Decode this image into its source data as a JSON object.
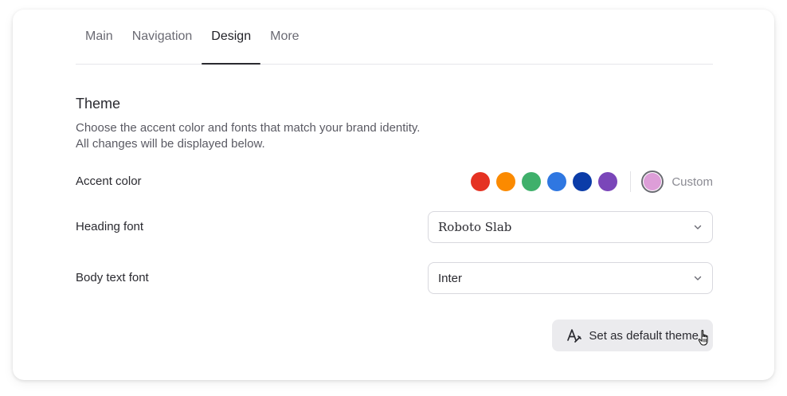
{
  "tabs": [
    {
      "label": "Main"
    },
    {
      "label": "Navigation"
    },
    {
      "label": "Design"
    },
    {
      "label": "More"
    }
  ],
  "active_tab": "Design",
  "theme": {
    "title": "Theme",
    "description_line1": "Choose the accent color and fonts that match your brand identity.",
    "description_line2": "All changes will be displayed below."
  },
  "accent": {
    "label": "Accent color",
    "colors": [
      "#e53222",
      "#fb8a00",
      "#3fb06b",
      "#2f77e1",
      "#0b3ca8",
      "#7a46b9"
    ],
    "custom_color": "#dd9ed8",
    "custom_label": "Custom"
  },
  "heading_font": {
    "label": "Heading font",
    "value": "Roboto Slab"
  },
  "body_font": {
    "label": "Body text font",
    "value": "Inter"
  },
  "actions": {
    "set_default_label": "Set as default theme"
  },
  "icons": {
    "chevron": "chevron-down-icon",
    "font_style": "font-style-icon",
    "cursor": "hand-pointer-icon"
  }
}
